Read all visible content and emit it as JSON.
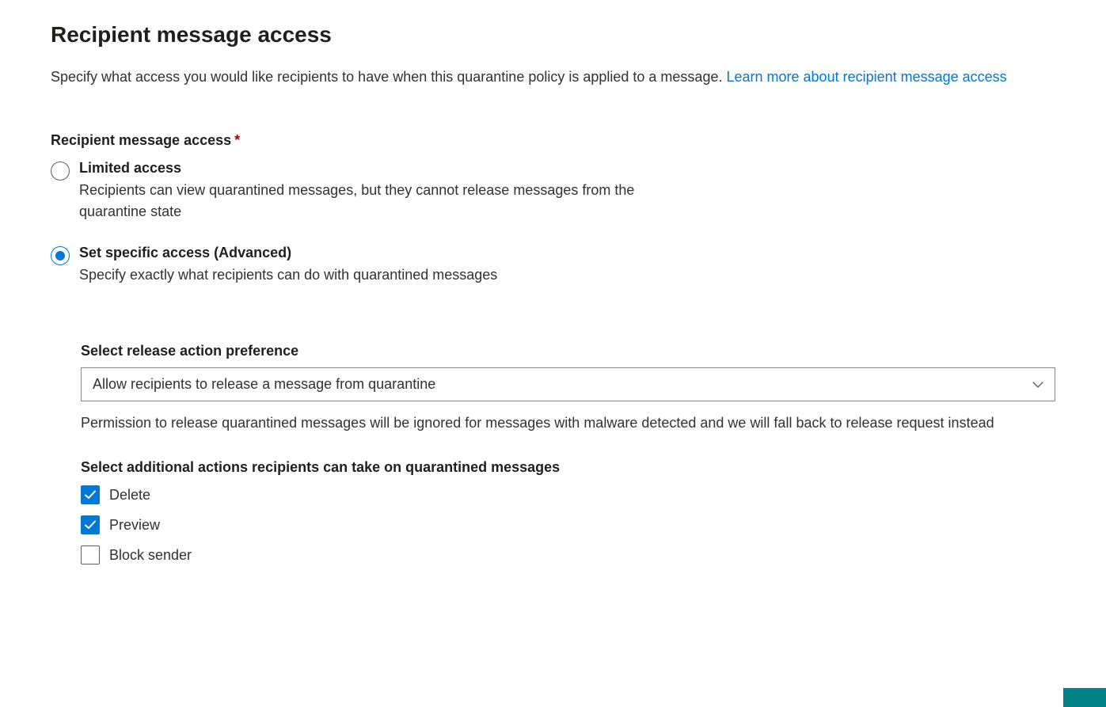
{
  "page": {
    "title": "Recipient message access",
    "intro_text": "Specify what access you would like recipients to have when this quarantine policy is applied to a message. ",
    "learn_more_link": "Learn more about recipient message access"
  },
  "field": {
    "label": "Recipient message access",
    "required_marker": "*"
  },
  "radio_options": {
    "limited": {
      "title": "Limited access",
      "description": "Recipients can view quarantined messages, but they cannot release messages from the quarantine state"
    },
    "specific": {
      "title": "Set specific access (Advanced)",
      "description": "Specify exactly what recipients can do with quarantined messages"
    },
    "selected": "specific"
  },
  "release_action": {
    "label": "Select release action preference",
    "selected_value": "Allow recipients to release a message from quarantine",
    "helper_text": "Permission to release quarantined messages will be ignored for messages with malware detected and we will fall back to release request instead"
  },
  "additional_actions": {
    "label": "Select additional actions recipients can take on quarantined messages",
    "options": [
      {
        "label": "Delete",
        "checked": true
      },
      {
        "label": "Preview",
        "checked": true
      },
      {
        "label": "Block sender",
        "checked": false
      }
    ]
  }
}
